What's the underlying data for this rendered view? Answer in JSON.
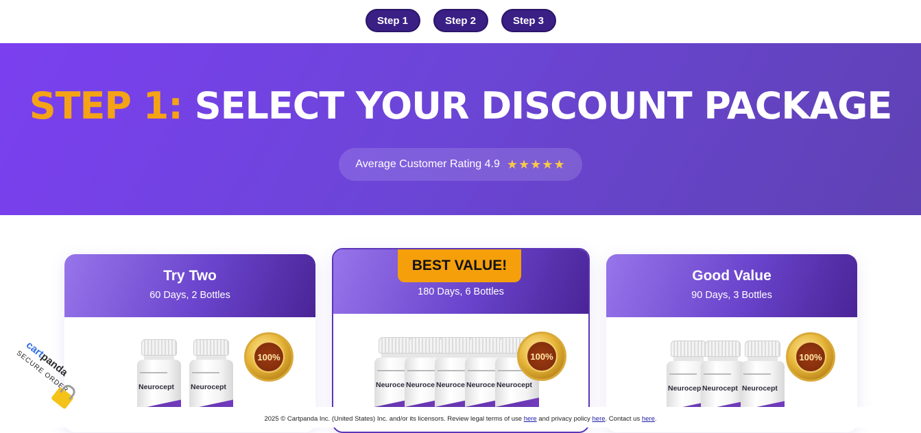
{
  "steps": [
    {
      "label": "Step 1"
    },
    {
      "label": "Step 2"
    },
    {
      "label": "Step 3"
    }
  ],
  "hero": {
    "title_accent": "STEP 1:",
    "title_main": "SELECT YOUR DISCOUNT PACKAGE",
    "rating_text": "Average Customer Rating 4.9",
    "stars": "★★★★★",
    "rating_value": 4.9
  },
  "packages": [
    {
      "title": "Try Two",
      "subtitle": "60 Days, 2 Bottles",
      "bottles": 2
    },
    {
      "badge": "BEST VALUE!",
      "subtitle": "180 Days, 6 Bottles",
      "bottles": 6
    },
    {
      "title": "Good Value",
      "subtitle": "90 Days, 3 Bottles",
      "bottles": 3
    }
  ],
  "product": {
    "name": "Neurocept",
    "seal_text": "100%"
  },
  "secure_badge": {
    "brand_a": "cart",
    "brand_b": "panda",
    "sub": "SECURE ORDER"
  },
  "footer": {
    "text_1": "2025 © Cartpanda Inc. (United States) Inc. and/or its licensors. Review legal terms of use ",
    "link_terms": "here",
    "text_2": " and privacy policy ",
    "link_privacy": "here",
    "text_3": ". Contact us ",
    "link_contact": "here",
    "text_4": "."
  },
  "colors": {
    "accent": "#f5a316",
    "step_pill": "#3a1f85",
    "hero_start": "#7b3ff0",
    "hero_end": "#5f42b3",
    "badge": "#f59f0b"
  }
}
